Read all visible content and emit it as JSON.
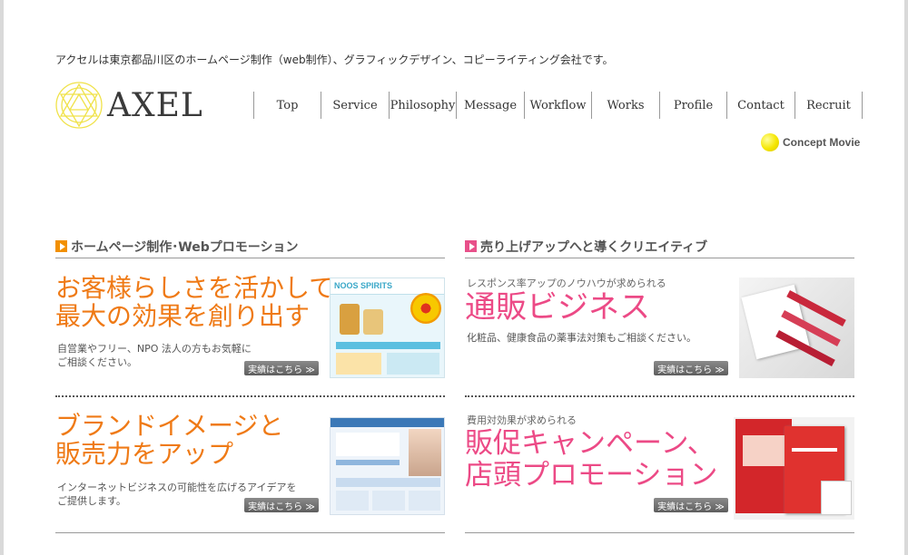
{
  "tagline": "アクセルは東京都品川区のホームページ制作（web制作）、グラフィックデザイン、コピーライティング会社です。",
  "logo": {
    "text": "AXEL"
  },
  "nav": [
    {
      "label": "Top"
    },
    {
      "label": "Service"
    },
    {
      "label": "Philosophy"
    },
    {
      "label": "Message"
    },
    {
      "label": "Workflow"
    },
    {
      "label": "Works"
    },
    {
      "label": "Profile"
    },
    {
      "label": "Contact"
    },
    {
      "label": "Recruit"
    }
  ],
  "concept_movie": {
    "label": "Concept Movie"
  },
  "colors": {
    "accent_orange": "#ef7a16",
    "accent_pink": "#ec4a86",
    "concept_dot": "#f5e600"
  },
  "left_column": {
    "heading": "ホームページ制作･Webプロモーション",
    "panels": [
      {
        "headline_1": "お客様らしさを活かして",
        "headline_2": "最大の効果を創り出す",
        "desc_1": "自営業やフリー、NPO 法人の方もお気軽に",
        "desc_2": "ご相談ください。",
        "button": "実績はこちら ≫",
        "thumb_title": "NOOS SPIRITS"
      },
      {
        "headline_1": "ブランドイメージと",
        "headline_2": "販売力をアップ",
        "desc_1": "インターネットビジネスの可能性を広げるアイデアを",
        "desc_2": "ご提供します。",
        "button": "実績はこちら ≫",
        "thumb_title": ""
      }
    ]
  },
  "right_column": {
    "heading": "売り上げアップへと導くクリエイティブ",
    "panels": [
      {
        "sub": "レスポンス率アップのノウハウが求められる",
        "headline_1": "通販ビジネス",
        "desc_1": "化粧品、健康食品の薬事法対策もご相談ください。",
        "button": "実績はこちら ≫"
      },
      {
        "sub": "費用対効果が求められる",
        "headline_1": "販促キャンペーン、",
        "headline_2": "店頭プロモーション",
        "button": "実績はこちら ≫"
      }
    ]
  }
}
